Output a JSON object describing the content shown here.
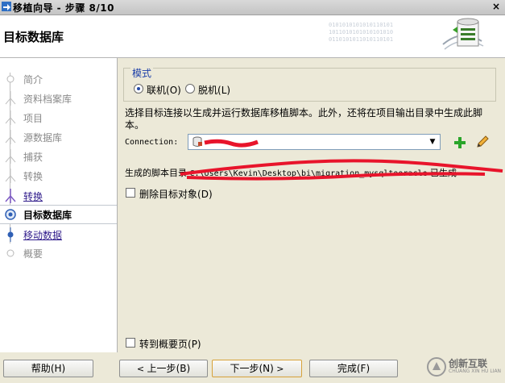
{
  "window": {
    "title": "移植向导 - 步骤 8/10",
    "close_label": "×"
  },
  "header": {
    "heading": "目标数据库",
    "binary_text": "0101010101010110101\n1011010101010101010\n0110101011010110101"
  },
  "steps": [
    {
      "label": "简介",
      "state": "done"
    },
    {
      "label": "资料档案库",
      "state": "done"
    },
    {
      "label": "项目",
      "state": "done"
    },
    {
      "label": "源数据库",
      "state": "done"
    },
    {
      "label": "捕获",
      "state": "done"
    },
    {
      "label": "转换",
      "state": "done"
    },
    {
      "label": "转换",
      "state": "link"
    },
    {
      "label": "目标数据库",
      "state": "current"
    },
    {
      "label": "移动数据",
      "state": "link"
    },
    {
      "label": "概要",
      "state": "future"
    }
  ],
  "mode": {
    "legend": "模式",
    "online_label": "联机",
    "online_key": "(O)",
    "offline_label": "脱机",
    "offline_key": "(L)",
    "selected": "online"
  },
  "description": "选择目标连接以生成并运行数据库移植脚本。此外，还将在项目输出目录中生成此脚本。",
  "connection": {
    "label": "Connection:",
    "value": ""
  },
  "script": {
    "prefix": "生成的脚本目录",
    "path": "C:\\Users\\Kevin\\Desktop\\bi\\migration_mysqltooracle",
    "suffix": "已生成"
  },
  "options": {
    "drop_target_label": "删除目标对象",
    "drop_target_key": "(D)",
    "goto_summary_label": "转到概要页",
    "goto_summary_key": "(P)"
  },
  "buttons": {
    "help": "帮助",
    "help_key": "(H)",
    "back": "上一步",
    "back_key": "(B)",
    "next": "下一步",
    "next_key": "(N)",
    "finish": "完成",
    "finish_key": "(F)"
  },
  "watermark": {
    "title": "创新互联",
    "subtitle": "CHUANG XIN HU LIAN"
  },
  "colors": {
    "link": "#2e1a8a",
    "legend": "#1c3fa8",
    "redaction": "#e8142b",
    "add": "#2aa52a"
  }
}
